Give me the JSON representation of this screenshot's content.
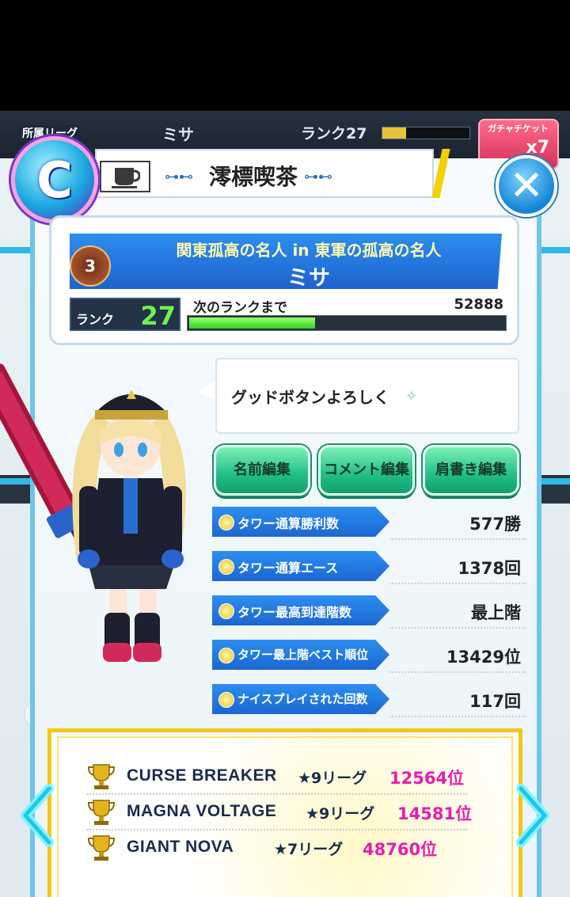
{
  "background": {
    "player_name": "ミサ",
    "rank_text": "ランク27",
    "ticket_label": "ガチャチケット",
    "ticket_count": "x7"
  },
  "header": {
    "league_label": "所属リーグ",
    "league_letter": "C",
    "title": "澪標喫茶",
    "title_icon": "coffee-cup-icon",
    "close_icon": "close-icon"
  },
  "profile": {
    "subtitle": "関東孤高の名人 in 東軍の孤高の名人",
    "name": "ミサ",
    "medal_number": "3",
    "rank_label": "ランク",
    "rank_value": "27",
    "next_rank_label": "次のランクまで",
    "next_rank_value": "52888",
    "xp_progress": 0.4
  },
  "comment": {
    "text": "グッドボタンよろしく"
  },
  "buttons": {
    "edit_name": "名前編集",
    "edit_comment": "コメント編集",
    "edit_title": "肩書き編集"
  },
  "stats": [
    {
      "label": "タワー通算勝利数",
      "value": "577勝"
    },
    {
      "label": "タワー通算エース",
      "value": "1378回"
    },
    {
      "label": "タワー最高到達階数",
      "value": "最上階"
    },
    {
      "label": "タワー最上階ベスト順位",
      "value": "13429位"
    },
    {
      "label": "ナイスプレイされた回数",
      "value": "117回"
    }
  ],
  "awards": [
    {
      "name": "CURSE BREAKER",
      "league": "★9リーグ",
      "rank": "12564位"
    },
    {
      "name": "MAGNA VOLTAGE",
      "league": "★9リーグ",
      "rank": "14581位"
    },
    {
      "name": "GIANT NOVA",
      "league": "★7リーグ",
      "rank": "48760位"
    }
  ],
  "colors": {
    "accent_blue": "#1d63cc",
    "button_green": "#1fbf85",
    "rank_green": "#6ef34e",
    "award_pink": "#e31fb0",
    "gold": "#f0c81a"
  }
}
